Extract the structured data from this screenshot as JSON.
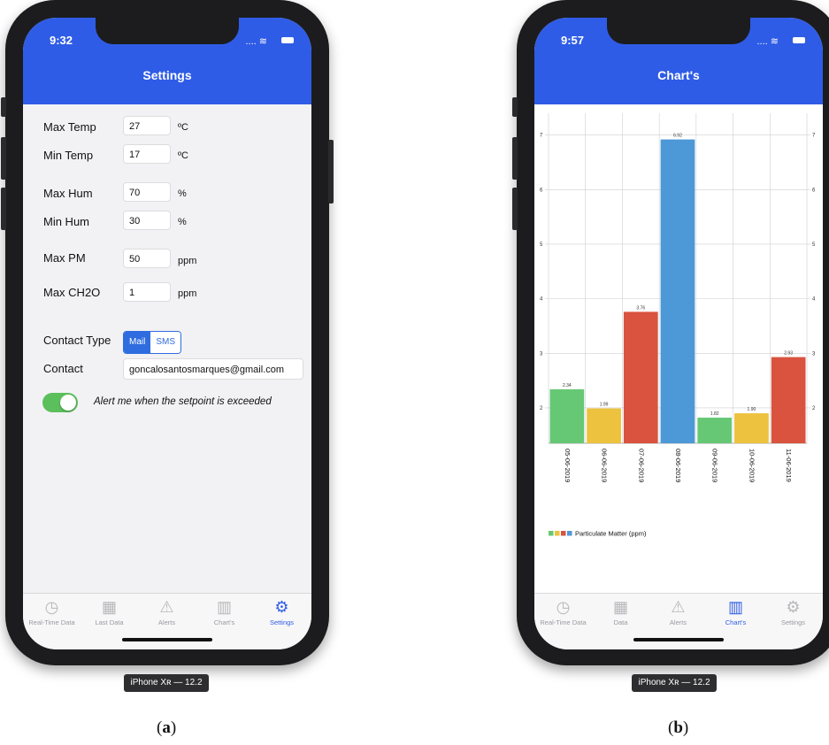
{
  "left": {
    "time": "9:32",
    "title": "Settings",
    "rows": [
      {
        "label": "Max Temp",
        "value": "27",
        "unit": "ºC"
      },
      {
        "label": "Min Temp",
        "value": "17",
        "unit": "ºC"
      },
      {
        "label": "Max Hum",
        "value": "70",
        "unit": "%"
      },
      {
        "label": "Min Hum",
        "value": "30",
        "unit": "%"
      },
      {
        "label": "Max PM",
        "value": "50",
        "unit": "ppm"
      },
      {
        "label": "Max CH2O",
        "value": "1",
        "unit": "ppm"
      }
    ],
    "contact_type_label": "Contact Type",
    "contact_type_options": [
      "Mail",
      "SMS"
    ],
    "contact_label": "Contact",
    "contact_value": "goncalosantosmarques@gmail.com",
    "alert_toggle_text": "Alert me when the setpoint is exceeded",
    "alert_toggle_on": true,
    "tabs": [
      {
        "label": "Real-Time Data",
        "icon": "clock-icon"
      },
      {
        "label": "Last Data",
        "icon": "grid-icon"
      },
      {
        "label": "Alerts",
        "icon": "warning-icon"
      },
      {
        "label": "Chart's",
        "icon": "chart-icon"
      },
      {
        "label": "Settings",
        "icon": "gear-icon"
      }
    ],
    "active_tab": "Settings",
    "device": "iPhone Xʀ — 12.2",
    "caption_letter": "a"
  },
  "right": {
    "time": "9:57",
    "title": "Chart's",
    "tabs": [
      {
        "label": "Real-Time Data",
        "icon": "clock-icon"
      },
      {
        "label": "Data",
        "icon": "grid-icon"
      },
      {
        "label": "Alerts",
        "icon": "warning-icon"
      },
      {
        "label": "Chart's",
        "icon": "chart-icon"
      },
      {
        "label": "Settings",
        "icon": "gear-icon"
      }
    ],
    "active_tab": "Chart's",
    "device": "iPhone Xʀ — 12.2",
    "caption_letter": "b"
  },
  "chart_data": {
    "type": "bar",
    "categories": [
      "05-06-2019",
      "06-06-2019",
      "07-06-2019",
      "08-06-2019",
      "09-06-2019",
      "10-06-2019",
      "11-06-2019"
    ],
    "values": [
      2.34,
      1.99,
      3.76,
      6.92,
      1.82,
      1.9,
      2.93
    ],
    "value_labels": [
      "2.34",
      "1.99",
      "3.76",
      "6.92",
      "1.82",
      "1.90",
      "2.93"
    ],
    "bar_colors": [
      "#66c874",
      "#ecc23e",
      "#d9533e",
      "#4d98d6",
      "#66c874",
      "#ecc23e",
      "#d9533e"
    ],
    "ylim": [
      1.35,
      7.4
    ],
    "yticks": [
      2,
      3,
      4,
      5,
      6,
      7
    ],
    "grid": true,
    "legend": {
      "label": "Particulate Matter (ppm)",
      "colors": [
        "#66c874",
        "#ecc23e",
        "#d9533e",
        "#4d98d6"
      ],
      "position": "bottom-left"
    }
  }
}
